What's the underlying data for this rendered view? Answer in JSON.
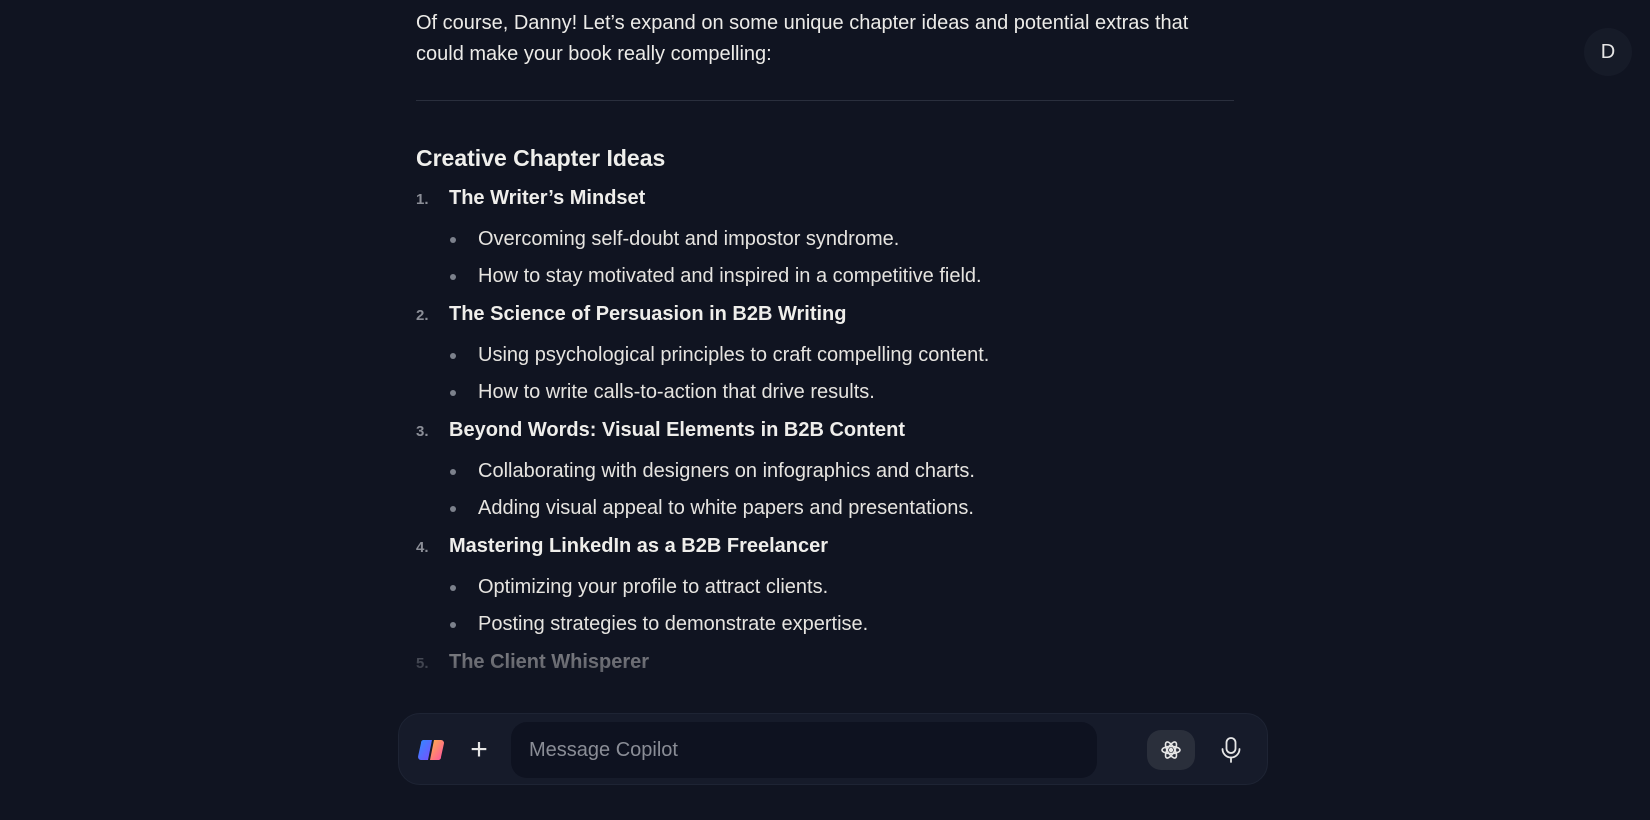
{
  "avatar": {
    "initial": "D"
  },
  "message": {
    "intro": "Of course, Danny! Let’s expand on some unique chapter ideas and potential extras that could make your book really compelling:",
    "heading": "Creative Chapter Ideas",
    "chapters": [
      {
        "num": "1.",
        "title": "The Writer’s Mindset",
        "bullets": [
          "Overcoming self-doubt and impostor syndrome.",
          "How to stay motivated and inspired in a competitive field."
        ]
      },
      {
        "num": "2.",
        "title": "The Science of Persuasion in B2B Writing",
        "bullets": [
          "Using psychological principles to craft compelling content.",
          "How to write calls-to-action that drive results."
        ]
      },
      {
        "num": "3.",
        "title": "Beyond Words: Visual Elements in B2B Content",
        "bullets": [
          "Collaborating with designers on infographics and charts.",
          "Adding visual appeal to white papers and presentations."
        ]
      },
      {
        "num": "4.",
        "title": "Mastering LinkedIn as a B2B Freelancer",
        "bullets": [
          "Optimizing your profile to attract clients.",
          "Posting strategies to demonstrate expertise."
        ]
      },
      {
        "num": "5.",
        "title": "The Client Whisperer",
        "bullets": []
      }
    ]
  },
  "composer": {
    "placeholder": "Message Copilot",
    "plus_label": "+"
  },
  "colors": {
    "background": "#101421",
    "composer": "#161b2a",
    "input": "#0e1220",
    "text": "#e8e6e3"
  }
}
